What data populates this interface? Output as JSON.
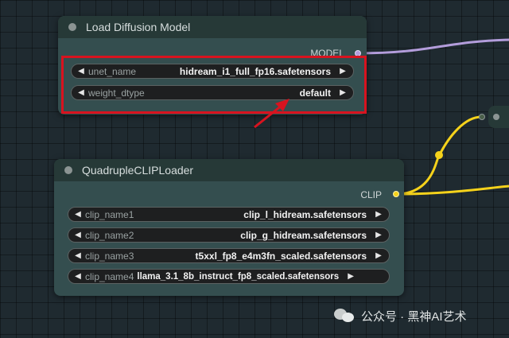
{
  "colors": {
    "model_wire": "#b39ddb",
    "clip_wire": "#f5d21b",
    "highlight": "#d8131f"
  },
  "load_diffusion_model": {
    "title": "Load Diffusion Model",
    "output_label": "MODEL",
    "widgets": [
      {
        "label": "unet_name",
        "value": "hidream_i1_full_fp16.safetensors"
      },
      {
        "label": "weight_dtype",
        "value": "default"
      }
    ]
  },
  "quadruple_clip_loader": {
    "title": "QuadrupleCLIPLoader",
    "output_label": "CLIP",
    "widgets": [
      {
        "label": "clip_name1",
        "value": "clip_l_hidream.safetensors"
      },
      {
        "label": "clip_name2",
        "value": "clip_g_hidream.safetensors"
      },
      {
        "label": "clip_name3",
        "value": "t5xxl_fp8_e4m3fn_scaled.safetensors"
      },
      {
        "label": "clip_name4",
        "value": "llama_3.1_8b_instruct_fp8_scaled.safetensors"
      }
    ]
  },
  "icons": {
    "left_arrow": "◀",
    "right_arrow": "▶"
  },
  "watermark": {
    "text": "公众号 · 黑神AI艺术"
  }
}
